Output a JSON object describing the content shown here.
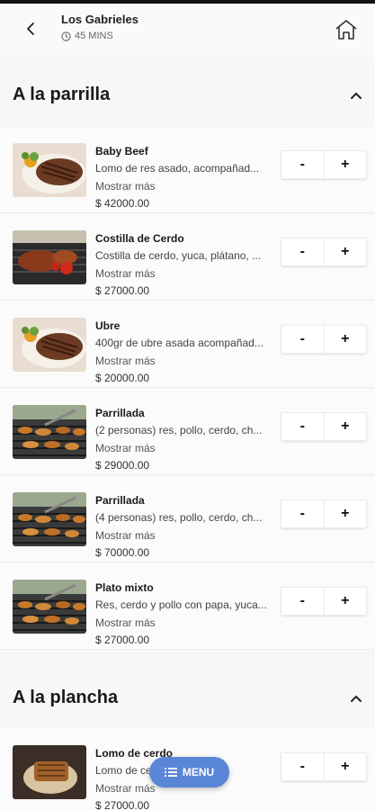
{
  "header": {
    "restaurant_name": "Los Gabrieles",
    "delivery_time": "45 MINS"
  },
  "sections": [
    {
      "title": "A la parrilla",
      "items": [
        {
          "name": "Baby Beef",
          "description": "Lomo de res asado, acompañad...",
          "more_label": "Mostrar más",
          "price": "$ 42000.00",
          "image": "steak-plate"
        },
        {
          "name": "Costilla de Cerdo",
          "description": "Costilla de cerdo, yuca, plátano, ...",
          "more_label": "Mostrar más",
          "price": "$ 27000.00",
          "image": "grilled-ribs"
        },
        {
          "name": "Ubre",
          "description": "400gr de ubre asada acompañad...",
          "more_label": "Mostrar más",
          "price": "$ 20000.00",
          "image": "steak-plate"
        },
        {
          "name": "Parrillada",
          "description": "(2 personas) res, pollo, cerdo, ch...",
          "more_label": "Mostrar más",
          "price": "$ 29000.00",
          "image": "bbq-grill"
        },
        {
          "name": "Parrillada",
          "description": "(4 personas) res, pollo, cerdo, ch...",
          "more_label": "Mostrar más",
          "price": "$ 70000.00",
          "image": "bbq-grill"
        },
        {
          "name": "Plato mixto",
          "description": "Res, cerdo y pollo con papa, yuca...",
          "more_label": "Mostrar más",
          "price": "$ 27000.00",
          "image": "bbq-grill"
        }
      ]
    },
    {
      "title": "A la plancha",
      "items": [
        {
          "name": "Lomo de cerdo",
          "description": "Lomo de cerdo en salsa...",
          "more_label": "Mostrar más",
          "price": "$ 27000.00",
          "image": "pork-loin"
        }
      ]
    }
  ],
  "qty_controls": {
    "minus": "-",
    "plus": "+"
  },
  "fab": {
    "label": "MENU"
  },
  "colors": {
    "accent": "#5a86d8",
    "background": "#f7f7f7",
    "card": "#fbfbfb"
  }
}
